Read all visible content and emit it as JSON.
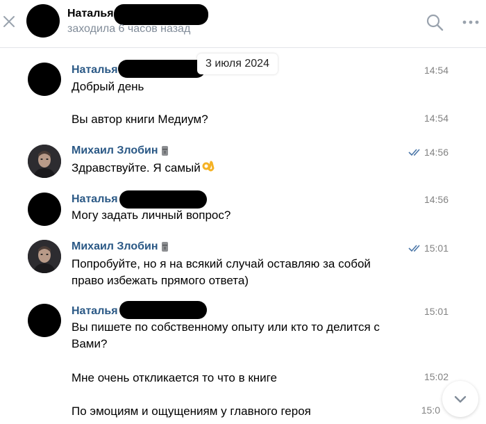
{
  "header": {
    "name": "Наталья",
    "status": "заходила 6 часов назад"
  },
  "date_badge": "3 июля 2024",
  "messages": [
    {
      "author": "Наталья",
      "text": "Добрый день",
      "time": "14:54"
    },
    {
      "text": "Вы автор книги Медиум?",
      "time": "14:54"
    },
    {
      "author": "Михаил Злобин",
      "text": "Здравствуйте. Я самый",
      "time": "14:56"
    },
    {
      "author": "Наталья",
      "text": "Могу задать личный вопрос?",
      "time": "14:56"
    },
    {
      "author": "Михаил Злобин",
      "text_line1": "Попробуйте, но я на всякий случай оставляю за собой",
      "text_line2": "право избежать прямого ответа)",
      "time": "15:01"
    },
    {
      "author": "Наталья",
      "text_line1": "Вы пишете по собственному опыту или кто то делится с",
      "text_line2": "Вами?",
      "time": "15:01"
    },
    {
      "text": "Мне очень откликается то что в книге",
      "time": "15:02"
    },
    {
      "text": "По эмоциям и ощущениям у главного героя",
      "time": "15:0"
    }
  ],
  "icons": {
    "close": "close-icon",
    "search": "search-icon",
    "more": "more-icon",
    "read": "double-check-icon",
    "emoji_ok": "ok-hand-emoji",
    "moai": "moai-emoji",
    "scroll_down": "chevron-down-icon"
  },
  "colors": {
    "author": "#2a5885",
    "muted": "#818c99",
    "read_check": "#4a76a8"
  }
}
